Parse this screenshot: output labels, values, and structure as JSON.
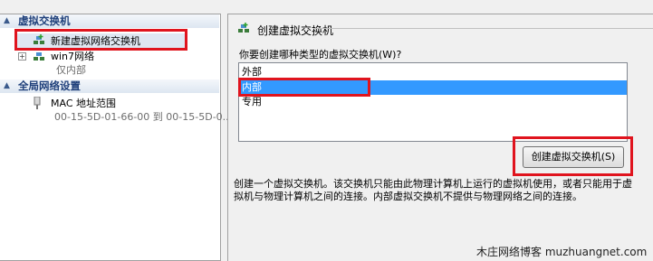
{
  "tree": {
    "section_switches": "虚拟交换机",
    "item_new_switch": "新建虚拟网络交换机",
    "item_win7": "win7网络",
    "item_win7_sub": "仅内部",
    "section_global": "全局网络设置",
    "item_mac": "MAC 地址范围",
    "item_mac_sub": "00-15-5D-01-66-00 到 00-15-5D-0..."
  },
  "form": {
    "header": "创建虚拟交换机",
    "question": "你要创建哪种类型的虚拟交换机(W)?",
    "options": [
      "外部",
      "内部",
      "专用"
    ],
    "selected": "内部",
    "create_button": "创建虚拟交换机(S)",
    "description": "创建一个虚拟交换机。该交换机只能由此物理计算机上运行的虚拟机使用，或者只能用于虚拟机与物理计算机之间的连接。内部虚拟交换机不提供与物理网络之间的连接。"
  },
  "watermark": "木庄网络博客 muzhuangnet.com",
  "colors": {
    "selection": "#3399ff",
    "highlight_box": "#e0141e",
    "section_text": "#1e3f7a"
  },
  "icons": [
    "chevron-up-icon",
    "network-add-icon",
    "network-icon",
    "expand-plus-icon",
    "mac-address-icon"
  ]
}
